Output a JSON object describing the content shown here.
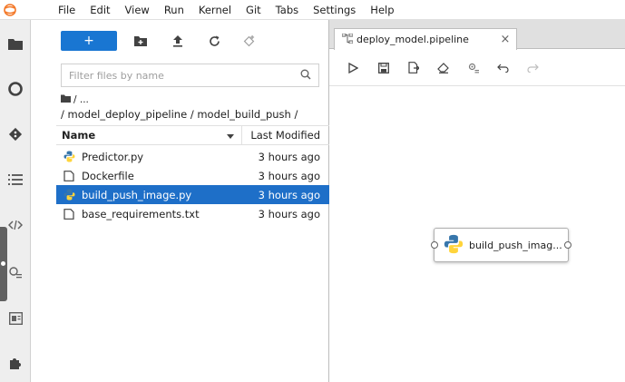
{
  "menubar": {
    "items": [
      "File",
      "Edit",
      "View",
      "Run",
      "Kernel",
      "Git",
      "Tabs",
      "Settings",
      "Help"
    ]
  },
  "filebrowser": {
    "new_label": "+",
    "filter_placeholder": "Filter files by name",
    "breadcrumb_root": "/ ...",
    "breadcrumb_path": "/ model_deploy_pipeline / model_build_push /",
    "columns": {
      "name": "Name",
      "modified": "Last Modified"
    },
    "files": [
      {
        "name": "Predictor.py",
        "modified": "3 hours ago",
        "type": "python"
      },
      {
        "name": "Dockerfile",
        "modified": "3 hours ago",
        "type": "file"
      },
      {
        "name": "build_push_image.py",
        "modified": "3 hours ago",
        "type": "python"
      },
      {
        "name": "base_requirements.txt",
        "modified": "3 hours ago",
        "type": "file"
      }
    ]
  },
  "main": {
    "tab_label": "deploy_model.pipeline",
    "tab_close": "×",
    "node_label": "build_push_imag..."
  },
  "colors": {
    "accent": "#1976d2",
    "selection": "#1e6fc8"
  }
}
